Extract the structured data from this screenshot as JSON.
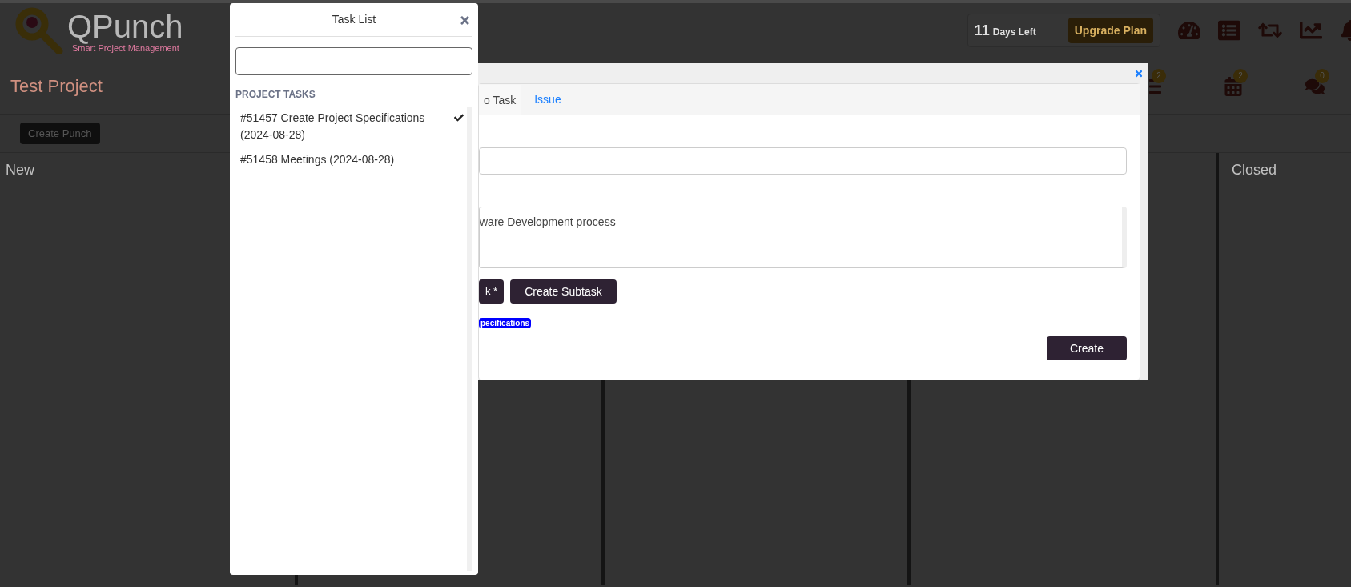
{
  "header": {
    "logo": {
      "name": "QPunch",
      "tagline": "Smart Project Management"
    },
    "trial": {
      "days": "11",
      "label": "Days Left"
    },
    "upgrade_button": "Upgrade Plan"
  },
  "project": {
    "title": "Test Project",
    "counters": [
      {
        "count": "2"
      },
      {
        "count": "2"
      },
      {
        "count": "0"
      }
    ]
  },
  "toolbar": {
    "create_button": "Create Punch"
  },
  "board": {
    "columns": [
      {
        "title": "New"
      },
      {
        "title": "Closed"
      }
    ]
  },
  "task_modal": {
    "tabs": [
      {
        "label": "o Task",
        "selected": true
      },
      {
        "label": "Issue",
        "selected": false
      }
    ],
    "description": "ware Development process",
    "buttons": [
      "k *",
      "Create Subtask"
    ],
    "tag": "pecifications",
    "submit_button": "Create"
  },
  "task_list_panel": {
    "title": "Task List",
    "section": "PROJECT TASKS",
    "tasks": [
      {
        "label": "#51457 Create Project Specifications (2024-08-28)",
        "selected": true
      },
      {
        "label": "#51458 Meetings (2024-08-28)",
        "selected": false
      }
    ]
  }
}
